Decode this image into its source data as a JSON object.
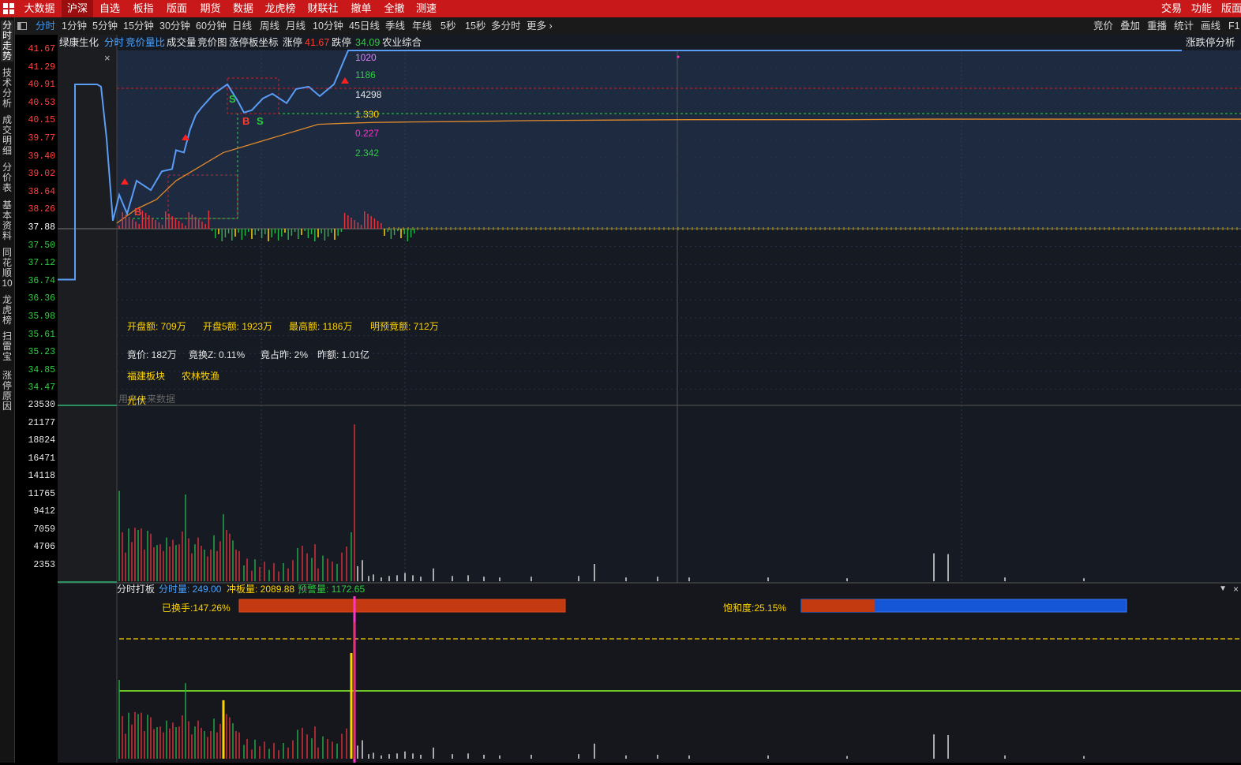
{
  "menubar": {
    "items": [
      "大数据",
      "沪深",
      "自选",
      "板指",
      "版面",
      "期货",
      "数据",
      "龙虎榜",
      "财联社",
      "撤单",
      "全撤",
      "测速"
    ],
    "active": "沪深",
    "right_items": [
      "交易",
      "功能",
      "版面"
    ]
  },
  "toolbar": {
    "periods": [
      "分时",
      "1分钟",
      "5分钟",
      "15分钟",
      "30分钟",
      "60分钟",
      "日线",
      "周线",
      "月线",
      "10分钟",
      "45日线",
      "季线",
      "年线",
      "5秒",
      "15秒",
      "多分时",
      "更多 ›"
    ],
    "active": "分时",
    "right_items": [
      "竞价",
      "叠加",
      "重播",
      "统计",
      "画线",
      "F1"
    ]
  },
  "sidebar": {
    "tabs": [
      "分时走势",
      "技术分析",
      "成交明细",
      "分价表",
      "基本资料",
      "同花顺10",
      "龙虎榜",
      "扫雷宝",
      "涨停原因"
    ]
  },
  "info": {
    "stock_name": "绿康生化",
    "mode": "分时",
    "indicator": "竞价量比",
    "volume_label": "成交量",
    "auction_chart": "竞价图",
    "limit_coord": "涨停板坐标",
    "limit_up_label": "涨停",
    "limit_up_value": "41.67",
    "limit_down_label": "跌停",
    "limit_down_value": "34.09",
    "sector": "农业综合",
    "right_label": "涨跌停分析"
  },
  "price_axis": [
    "41.67",
    "41.29",
    "40.91",
    "40.53",
    "40.15",
    "39.77",
    "39.40",
    "39.02",
    "38.64",
    "38.26",
    "37.88",
    "37.50",
    "37.12",
    "36.74",
    "36.36",
    "35.98",
    "35.61",
    "35.23",
    "34.85",
    "34.47"
  ],
  "volume_axis": [
    "23530",
    "21177",
    "18824",
    "16471",
    "14118",
    "11765",
    "9412",
    "7059",
    "4706",
    "2353"
  ],
  "price_labels": {
    "v1": "1020",
    "v2": "1186",
    "v3": "14298",
    "v4": "1.330",
    "v5": "0.227",
    "v6": "2.342"
  },
  "markers": [
    "B",
    "S",
    "B",
    "S"
  ],
  "auction_info": {
    "line1": [
      "开盘额: 709万",
      "开盘5额: 1923万",
      "最高额: 1186万",
      "明预竟额: 712万"
    ],
    "line2": [
      "竟价: 182万",
      "竟换Z: 0.11%",
      "竟占昨: 2%",
      "昨额: 1.01亿"
    ],
    "tags": [
      "福建板块",
      "农林牧渔"
    ],
    "hint": "用户未来数据",
    "tag3": "光伏"
  },
  "bottom_panel": {
    "title": "分时打板",
    "fen_label": "分时量: 249.00",
    "chong_label": "冲板量: 2089.88",
    "yujing_label": "预警量: 1172.65",
    "turnover_label": "已换手:147.26%",
    "turnover_fraction": 1.0,
    "saturation_label": "饱和度:25.15%",
    "saturation": 0.2515
  },
  "colors": {
    "price_line": "#5b9cf5",
    "avg_line": "#e08a2c",
    "up": "#e2323c",
    "down": "#24b24a",
    "yellow": "#ffd400",
    "magenta": "#ff33cc",
    "green_line": "#8cff2a"
  },
  "chart_data": {
    "type": "line",
    "price_series_name": "",
    "price": [
      36.8,
      36.8,
      40.95,
      40.95,
      40.9,
      39.8,
      38.05,
      38.6,
      38.2,
      38.9,
      38.7,
      39.1,
      39.15,
      39.55,
      39.5,
      40.0,
      40.3,
      40.45,
      40.75,
      40.95,
      40.6,
      40.35,
      40.4,
      40.65,
      40.75,
      40.55,
      40.85,
      40.9,
      40.7,
      40.95,
      41.67,
      41.67
    ],
    "avg_price": [
      38.0,
      38.3,
      38.5,
      38.9,
      39.1,
      39.3,
      39.5,
      39.6,
      39.7,
      39.8,
      39.9,
      40.0,
      40.1,
      40.12,
      40.14,
      40.15,
      40.16,
      40.18,
      40.2,
      40.2,
      40.21,
      40.21
    ],
    "ylim": [
      34.47,
      41.67
    ],
    "volume_ylim": [
      0,
      23530
    ]
  }
}
